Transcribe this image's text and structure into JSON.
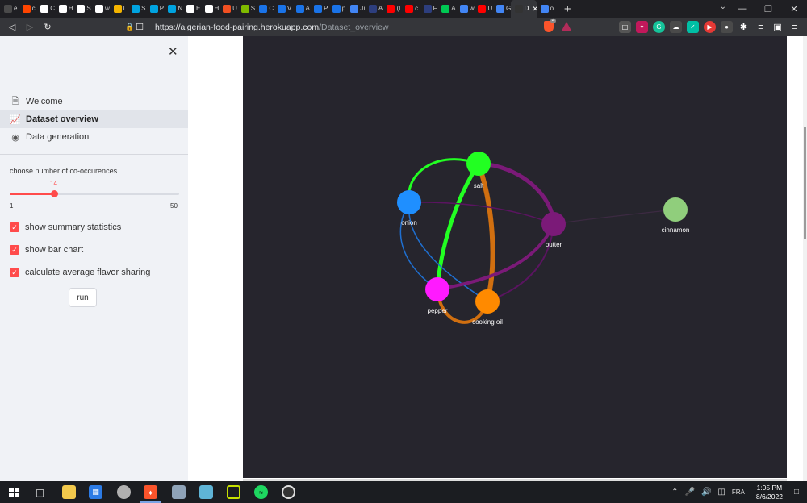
{
  "browser": {
    "tabs": [
      {
        "letter": "e",
        "color": "#4a4a4a"
      },
      {
        "letter": "c",
        "color": "#ff4500"
      },
      {
        "letter": "C",
        "color": "#ffffff"
      },
      {
        "letter": "H",
        "color": "#ffffff"
      },
      {
        "letter": "S",
        "color": "#ffffff"
      },
      {
        "letter": "w",
        "color": "#ffffff"
      },
      {
        "letter": "L",
        "color": "#f4b400"
      },
      {
        "letter": "S",
        "color": "#00a3e0"
      },
      {
        "letter": "P",
        "color": "#00a3e0"
      },
      {
        "letter": "N",
        "color": "#00a3e0"
      },
      {
        "letter": "E",
        "color": "#ffffff"
      },
      {
        "letter": "H",
        "color": "#ffffff"
      },
      {
        "letter": "U",
        "color": "#f25022"
      },
      {
        "letter": "S",
        "color": "#7fba00"
      },
      {
        "letter": "C",
        "color": "#1a73e8"
      },
      {
        "letter": "V",
        "color": "#1a73e8"
      },
      {
        "letter": "A",
        "color": "#1a73e8"
      },
      {
        "letter": "P",
        "color": "#1a73e8"
      },
      {
        "letter": "p",
        "color": "#1a73e8"
      },
      {
        "letter": "Jı",
        "color": "#4285f4"
      },
      {
        "letter": "A",
        "color": "#2d3e7e"
      },
      {
        "letter": "(I",
        "color": "#ff0000"
      },
      {
        "letter": "c",
        "color": "#ff0000"
      },
      {
        "letter": "F",
        "color": "#2d3e7e"
      },
      {
        "letter": "A",
        "color": "#00c853"
      },
      {
        "letter": "w",
        "color": "#4285f4"
      },
      {
        "letter": "U",
        "color": "#ff0000"
      },
      {
        "letter": "G",
        "color": "#4285f4"
      }
    ],
    "active_tab": {
      "letter": "D",
      "close": "✕"
    },
    "after_active_tab": {
      "letter": "o",
      "color": "#4285f4"
    },
    "new_tab": "+",
    "url_host": "https://algerian-food-pairing.herokuapp.com",
    "url_path": "/Dataset_overview",
    "shield_count": "4"
  },
  "sidebar": {
    "close_icon": "✕",
    "nav": [
      {
        "label": "Welcome",
        "icon": "🗎"
      },
      {
        "label": "Dataset overview",
        "icon": "📈"
      },
      {
        "label": "Data generation",
        "icon": "◉"
      }
    ],
    "slider": {
      "label": "choose number of co-occurences",
      "value": "14",
      "min": "1",
      "max": "50"
    },
    "checkboxes": [
      {
        "label": "show summary statistics",
        "checked": true
      },
      {
        "label": "show bar chart",
        "checked": true
      },
      {
        "label": "calculate average flavor sharing",
        "checked": true
      }
    ],
    "run_button": "run"
  },
  "graph": {
    "nodes": [
      {
        "label": "salt",
        "color": "#22ff22"
      },
      {
        "label": "onion",
        "color": "#1f8fff"
      },
      {
        "label": "butter",
        "color": "#7b1a78"
      },
      {
        "label": "cinnamon",
        "color": "#90ce7c"
      },
      {
        "label": "pepper",
        "color": "#ff1aff"
      },
      {
        "label": "cooking oil",
        "color": "#ff8a00"
      }
    ]
  },
  "taskbar": {
    "language": "FRA",
    "time": "1:05 PM",
    "date": "8/6/2022"
  }
}
